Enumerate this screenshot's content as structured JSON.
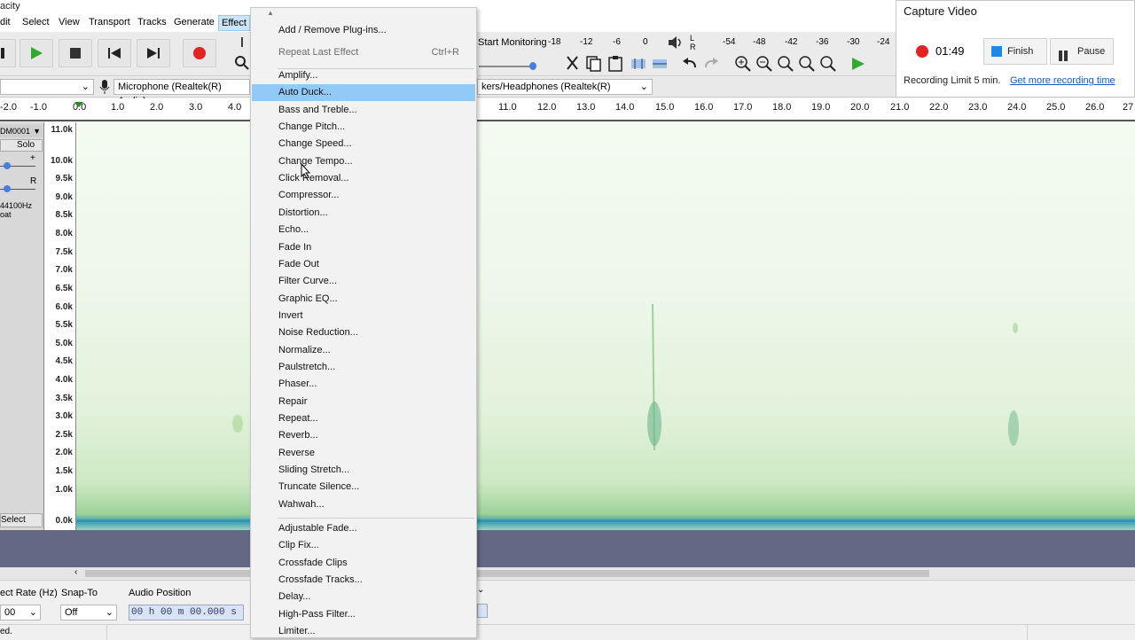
{
  "window": {
    "title_fragment": "acity"
  },
  "menubar": {
    "items": [
      "dit",
      "Select",
      "View",
      "Transport",
      "Tracks",
      "Generate",
      "Effect"
    ],
    "active": "Effect"
  },
  "meters": {
    "start_monitoring": "Start Monitoring",
    "rec_ticks": [
      "-18",
      "-12",
      "-6",
      "0"
    ],
    "play_ticks": [
      "-54",
      "-48",
      "-42",
      "-36",
      "-30",
      "-24"
    ],
    "lr": [
      "L",
      "R"
    ]
  },
  "devices": {
    "microphone": "Microphone (Realtek(R) Audio)",
    "speakers": "kers/Headphones (Realtek(R)"
  },
  "ruler": {
    "ticks_left": [
      "-2.0",
      "-1.0",
      "0.0",
      "1.0",
      "2.0",
      "3.0",
      "4.0"
    ],
    "ticks_right": [
      "11.0",
      "12.0",
      "13.0",
      "14.0",
      "15.0",
      "16.0",
      "17.0",
      "18.0",
      "19.0",
      "20.0",
      "21.0",
      "22.0",
      "23.0",
      "24.0",
      "25.0",
      "26.0",
      "27"
    ]
  },
  "track": {
    "name": "DM0001",
    "solo": "Solo",
    "rate": "44100Hz",
    "format": "oat",
    "select": "Select",
    "r_label": "R",
    "plus": "+"
  },
  "vscale": [
    "11.0k",
    "10.0k",
    "9.5k",
    "9.0k",
    "8.5k",
    "8.0k",
    "7.5k",
    "7.0k",
    "6.5k",
    "6.0k",
    "5.5k",
    "5.0k",
    "4.5k",
    "4.0k",
    "3.5k",
    "3.0k",
    "2.5k",
    "2.0k",
    "1.5k",
    "1.0k",
    "0.0k"
  ],
  "effect_menu": {
    "group1": [
      {
        "label": "Add / Remove Plug-ins...",
        "disabled": false
      },
      {
        "label": "Repeat Last Effect",
        "shortcut": "Ctrl+R",
        "disabled": true
      }
    ],
    "group2": [
      "Amplify...",
      "Auto Duck...",
      "Bass and Treble...",
      "Change Pitch...",
      "Change Speed...",
      "Change Tempo...",
      "Click Removal...",
      "Compressor...",
      "Distortion...",
      "Echo...",
      "Fade In",
      "Fade Out",
      "Filter Curve...",
      "Graphic EQ...",
      "Invert",
      "Noise Reduction...",
      "Normalize...",
      "Paulstretch...",
      "Phaser...",
      "Repair",
      "Repeat...",
      "Reverb...",
      "Reverse",
      "Sliding Stretch...",
      "Truncate Silence...",
      "Wahwah..."
    ],
    "group3": [
      "Adjustable Fade...",
      "Clip Fix...",
      "Crossfade Clips",
      "Crossfade Tracks...",
      "Delay...",
      "High-Pass Filter...",
      "Limiter..."
    ],
    "highlighted": "Auto Duck..."
  },
  "selection_toolbar": {
    "rate_label": "ect Rate (Hz)",
    "rate_value": "00",
    "snap_label": "Snap-To",
    "snap_value": "Off",
    "audio_position_label": "Audio Position",
    "audio_position_value": "00 h 00 m 00.000 s"
  },
  "status": {
    "text": "ed."
  },
  "capture": {
    "title": "Capture Video",
    "timer": "01:49",
    "finish": "Finish",
    "pause": "Pause",
    "limit": "Recording Limit 5 min.",
    "link": "Get more recording time"
  },
  "colors": {
    "accent_blue": "#1e88e5",
    "record_red": "#e32222",
    "highlight": "#91c9f7",
    "spectro_green": "#9fd39a",
    "track_gap": "#636884"
  }
}
